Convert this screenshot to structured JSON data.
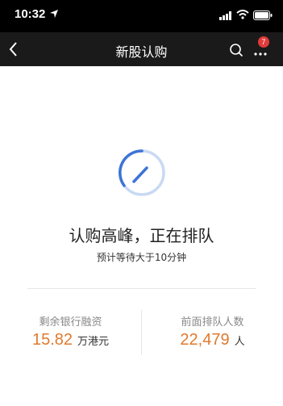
{
  "status_bar": {
    "time": "10:32"
  },
  "nav": {
    "title": "新股认购",
    "badge_count": "7"
  },
  "main": {
    "headline": "认购高峰，正在排队",
    "subtext": "预计等待大于10分钟"
  },
  "stats": {
    "left": {
      "label": "剩余银行融资",
      "value": "15.82",
      "unit": "万港元"
    },
    "right": {
      "label": "前面排队人数",
      "value": "22,479",
      "unit": "人"
    }
  },
  "colors": {
    "accent_orange": "#e07a2d",
    "spinner_blue": "#3d74d6",
    "badge_red": "#e23a3a"
  }
}
